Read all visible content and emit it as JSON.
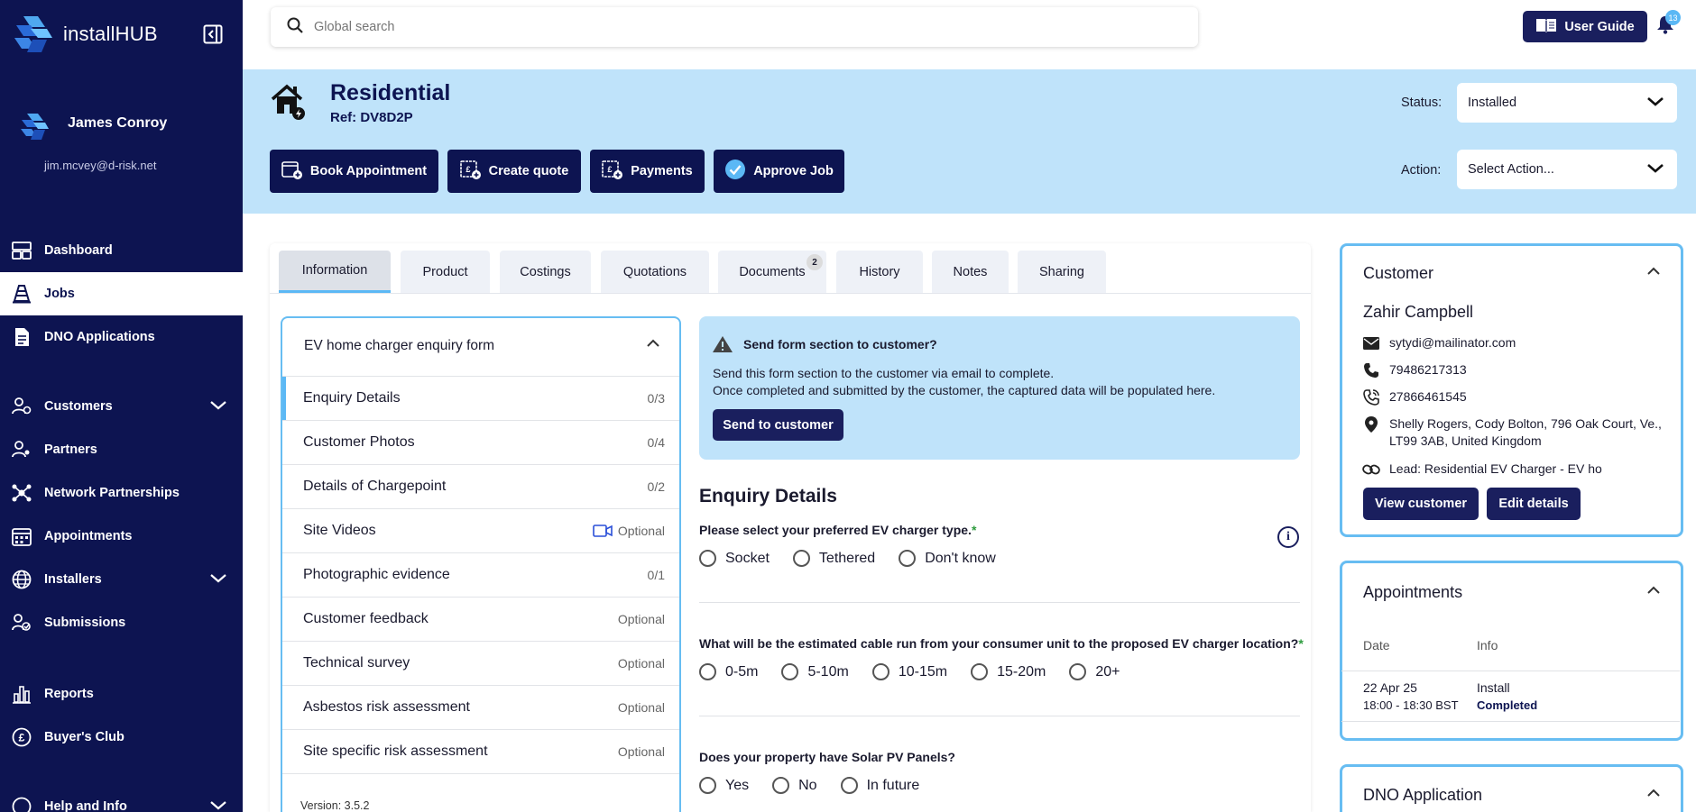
{
  "app": {
    "name": "installHUB"
  },
  "user": {
    "name": "James Conroy",
    "email": "jim.mcvey@d-risk.net"
  },
  "sidebar": {
    "items": [
      {
        "label": "Dashboard",
        "icon": "dashboard-icon"
      },
      {
        "label": "Jobs",
        "icon": "cone-icon",
        "active": true
      },
      {
        "label": "DNO Applications",
        "icon": "document-icon"
      },
      {
        "label": "Customers",
        "icon": "users-icon",
        "expandable": true
      },
      {
        "label": "Partners",
        "icon": "partners-icon"
      },
      {
        "label": "Network Partnerships",
        "icon": "network-icon"
      },
      {
        "label": "Appointments",
        "icon": "calendar-icon"
      },
      {
        "label": "Installers",
        "icon": "globe-icon",
        "expandable": true
      },
      {
        "label": "Submissions",
        "icon": "submissions-icon"
      },
      {
        "label": "Reports",
        "icon": "chart-icon"
      },
      {
        "label": "Buyer's Club",
        "icon": "pound-icon"
      },
      {
        "label": "Help and Info",
        "icon": "help-icon",
        "expandable": true
      }
    ]
  },
  "topbar": {
    "search_placeholder": "Global search",
    "user_guide_label": "User Guide",
    "notification_count": "13"
  },
  "job": {
    "title": "Residential",
    "ref": "Ref: DV8D2P",
    "buttons": {
      "book": "Book Appointment",
      "quote": "Create quote",
      "payments": "Payments",
      "approve": "Approve Job"
    },
    "status_label": "Status:",
    "status_value": "Installed",
    "action_label": "Action:",
    "action_value": "Select Action..."
  },
  "tabs": [
    {
      "label": "Information",
      "active": true
    },
    {
      "label": "Product"
    },
    {
      "label": "Costings"
    },
    {
      "label": "Quotations"
    },
    {
      "label": "Documents",
      "badge": "2"
    },
    {
      "label": "History"
    },
    {
      "label": "Notes"
    },
    {
      "label": "Sharing"
    }
  ],
  "form_list": {
    "title": "EV home charger enquiry form",
    "sections": [
      {
        "label": "Enquiry Details",
        "meta": "0/3"
      },
      {
        "label": "Customer Photos",
        "meta": "0/4"
      },
      {
        "label": "Details of Chargepoint",
        "meta": "0/2"
      },
      {
        "label": "Site Videos",
        "meta": "Optional"
      },
      {
        "label": "Photographic evidence",
        "meta": "0/1"
      },
      {
        "label": "Customer feedback",
        "meta": "Optional"
      },
      {
        "label": "Technical survey",
        "meta": "Optional"
      },
      {
        "label": "Asbestos risk assessment",
        "meta": "Optional"
      },
      {
        "label": "Site specific risk assessment",
        "meta": "Optional"
      }
    ],
    "version": "Version: 3.5.2"
  },
  "alert": {
    "title": "Send form section to customer?",
    "line1": "Send this form section to the customer via email to complete.",
    "line2": "Once completed and submitted by the customer, the captured data will be populated here.",
    "button": "Send to customer"
  },
  "enquiry": {
    "title": "Enquiry Details",
    "questions": [
      {
        "label": "Please select your preferred EV charger type.",
        "required": "*",
        "options": [
          "Socket",
          "Tethered",
          "Don't know"
        ]
      },
      {
        "label": "What will be the estimated cable run from your consumer unit to the proposed EV charger location?",
        "required": "*",
        "options": [
          "0-5m",
          "5-10m",
          "10-15m",
          "15-20m",
          "20+"
        ]
      },
      {
        "label": "Does your property have Solar PV Panels?",
        "required": "",
        "options": [
          "Yes",
          "No",
          "In future"
        ]
      }
    ],
    "info_glyph": "i"
  },
  "customer": {
    "title": "Customer",
    "name": "Zahir Campbell",
    "email": "sytydi@mailinator.com",
    "phone": "79486217313",
    "phone2": "27866461545",
    "address1": "Shelly Rogers, Cody Bolton, 796 Oak Court, Ve.,",
    "address2": "LT99 3AB, United Kingdom",
    "lead": "Lead: Residential EV Charger - EV ho",
    "view_button": "View customer",
    "edit_button": "Edit details"
  },
  "appointments": {
    "title": "Appointments",
    "col_date": "Date",
    "col_info": "Info",
    "rows": [
      {
        "date": "22 Apr 25",
        "time": "18:00 - 18:30 BST",
        "info": "Install",
        "status": "Completed"
      }
    ]
  },
  "dno": {
    "title": "DNO Application"
  },
  "colors": {
    "navy": "#0d1451",
    "accent": "#5bb8f5",
    "band": "#bfe3fa",
    "required": "#2e9c3e"
  }
}
